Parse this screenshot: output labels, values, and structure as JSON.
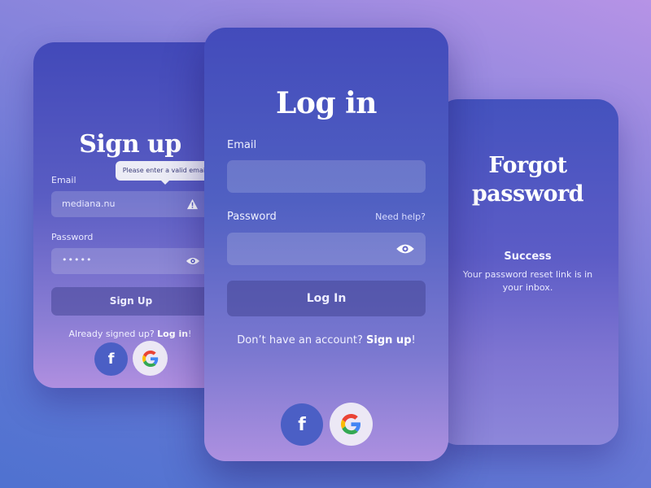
{
  "signup": {
    "title": "Sign up",
    "email_label": "Email",
    "email_value": "mediana.nu",
    "tooltip": "Please enter a valid email",
    "password_label": "Password",
    "password_value": "•••••",
    "button_label": "Sign Up",
    "prompt_text": "Already signed up? ",
    "prompt_link": "Log in",
    "prompt_end": "!"
  },
  "login": {
    "title": "Log in",
    "email_label": "Email",
    "password_label": "Password",
    "help_link": "Need help?",
    "button_label": "Log In",
    "prompt_text": "Don’t have an account? ",
    "prompt_link": "Sign up",
    "prompt_end": "!"
  },
  "forgot": {
    "title_line1": "Forgot",
    "title_line2": "password",
    "status": "Success",
    "message": "Your password reset link is in your inbox."
  },
  "social": {
    "facebook_glyph": "f",
    "icons": [
      "facebook-icon",
      "google-icon",
      "warning-icon",
      "eye-icon"
    ]
  },
  "colors": {
    "facebook": "#4b5fc5",
    "google_blue": "#4285F4",
    "google_red": "#EA4335",
    "google_yellow": "#FBBC05",
    "google_green": "#34A853"
  }
}
